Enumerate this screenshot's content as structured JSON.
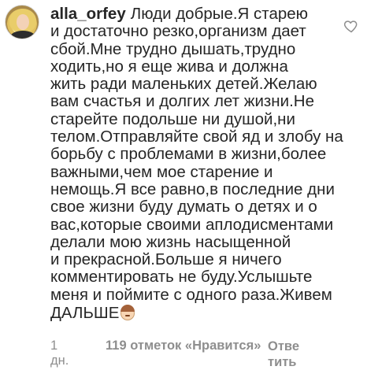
{
  "comment": {
    "username": "alla_orfey",
    "lines": [
      "Люди добрые.Я старею",
      "и достаточно резко,организм дает",
      "сбой.Мне трудно дышать,трудно",
      "ходить,но я еще жива и должна",
      "жить ради маленьких детей.Желаю",
      "вам счастья и долгих лет жизни.Не",
      "старейте подольше ни душой,ни",
      "телом.Отправляйте свой яд и злобу на",
      "борьбу с проблемами в жизни,более",
      "важными,чем мое старение и",
      "немощь.Я все равно,в последние дни",
      "свое жизни буду думать о детях и о",
      "вас,которые своими аплодисментами",
      "делали мою жизнь насыщенной",
      "и прекрасной.Больше я ничего",
      "комментировать не буду.Услышьте",
      "меня и поймите с одного раза.Живем",
      "ДАЛЬШЕ"
    ],
    "time": "1 дн.",
    "likes": "119 отметок «Нравится»",
    "reply_line1": "Отве",
    "reply_line2": "тить",
    "emoji_icon": "face-emoji",
    "heart_icon": "heart-outline"
  }
}
